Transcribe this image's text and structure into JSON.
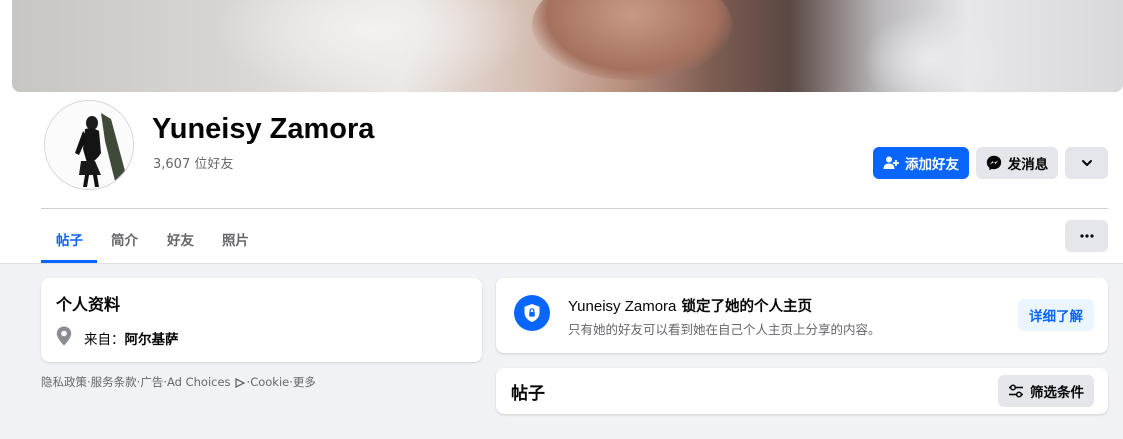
{
  "profile": {
    "name": "Yuneisy Zamora",
    "friends_count": "3,607 位好友"
  },
  "actions": {
    "add_friend": "添加好友",
    "message": "发消息"
  },
  "tabs": [
    {
      "label": "帖子",
      "active": true
    },
    {
      "label": "简介",
      "active": false
    },
    {
      "label": "好友",
      "active": false
    },
    {
      "label": "照片",
      "active": false
    }
  ],
  "intro": {
    "title": "个人资料",
    "from_label": "来自：",
    "from_value": "阿尔基萨"
  },
  "footer": {
    "links": [
      "隐私政策",
      "服务条款",
      "广告",
      "Ad Choices",
      "Cookie",
      "更多"
    ],
    "separator": " · "
  },
  "locked": {
    "name": "Yuneisy Zamora",
    "title_suffix": " 锁定了她的个人主页",
    "description": "只有她的好友可以看到她在自己个人主页上分享的内容。",
    "button": "详细了解"
  },
  "posts": {
    "title": "帖子",
    "filter_button": "筛选条件"
  },
  "colors": {
    "accent": "#0866ff",
    "background": "#f0f2f5",
    "secondary_button": "#e4e6eb",
    "muted_text": "#65676b"
  }
}
